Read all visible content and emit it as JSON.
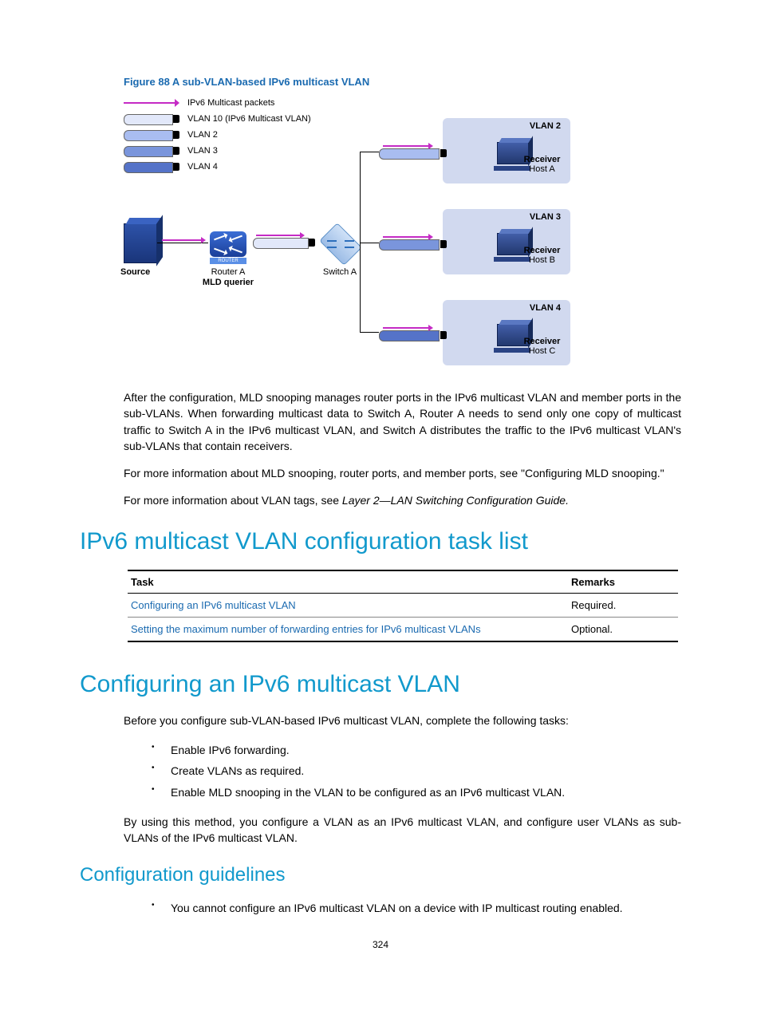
{
  "figure": {
    "caption": "Figure 88 A sub-VLAN-based IPv6 multicast VLAN",
    "legend": {
      "multicast_packets": "IPv6 Multicast packets",
      "vlan10": "VLAN 10 (IPv6 Multicast VLAN)",
      "vlan2": "VLAN 2",
      "vlan3": "VLAN 3",
      "vlan4": "VLAN 4"
    },
    "devices": {
      "source": "Source",
      "router_a": "Router A",
      "mld_querier": "MLD querier",
      "switch_a": "Switch A"
    },
    "groups": [
      {
        "title": "VLAN 2",
        "receiver_label": "Receiver",
        "host": "Host A"
      },
      {
        "title": "VLAN 3",
        "receiver_label": "Receiver",
        "host": "Host B"
      },
      {
        "title": "VLAN 4",
        "receiver_label": "Receiver",
        "host": "Host C"
      }
    ]
  },
  "paragraphs": {
    "p1": "After the configuration, MLD snooping manages router ports in the IPv6 multicast VLAN and member ports in the sub-VLANs. When forwarding multicast data to Switch A, Router A needs to send only one copy of multicast traffic to Switch A in the IPv6 multicast VLAN, and Switch A distributes the traffic to the IPv6 multicast VLAN's sub-VLANs that contain receivers.",
    "p2": "For more information about MLD snooping, router ports, and member ports, see \"Configuring MLD snooping.\"",
    "p3a": "For more information about VLAN tags, see ",
    "p3b": "Layer 2—LAN Switching Configuration Guide.",
    "p4": "Before you configure sub-VLAN-based IPv6 multicast VLAN, complete the following tasks:",
    "p5": "By using this method, you configure a VLAN as an IPv6 multicast VLAN, and configure user VLANs as sub-VLANs of the IPv6 multicast VLAN."
  },
  "headings": {
    "h1a": "IPv6 multicast VLAN configuration task list",
    "h1b": "Configuring an IPv6 multicast VLAN",
    "h2": "Configuration guidelines"
  },
  "table": {
    "head_task": "Task",
    "head_remarks": "Remarks",
    "rows": [
      {
        "task": "Configuring an IPv6 multicast VLAN",
        "remarks": "Required."
      },
      {
        "task": "Setting the maximum number of forwarding entries for IPv6 multicast VLANs",
        "remarks": "Optional."
      }
    ]
  },
  "bullets_a": [
    "Enable IPv6 forwarding.",
    "Create VLANs as required.",
    "Enable MLD snooping in the VLAN to be configured as an IPv6 multicast VLAN."
  ],
  "bullets_b": [
    "You cannot configure an IPv6 multicast VLAN on a device with IP multicast routing enabled."
  ],
  "page_number": "324"
}
